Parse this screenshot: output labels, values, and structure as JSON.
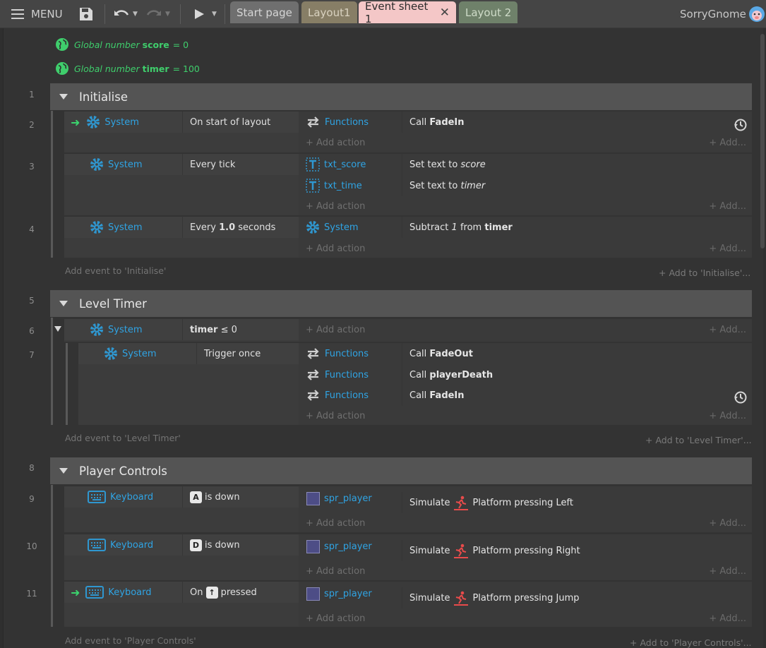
{
  "topbar": {
    "menu_label": "MENU",
    "user": "SorryGnome",
    "tabs": [
      {
        "label": "Start page"
      },
      {
        "label": "Layout1"
      },
      {
        "label": "Event sheet 1"
      },
      {
        "label": "Layout 2"
      }
    ]
  },
  "globals": [
    {
      "prefix": "Global number",
      "name": "score",
      "value": "= 0"
    },
    {
      "prefix": "Global number",
      "name": "timer",
      "value": "= 100"
    }
  ],
  "groups": [
    {
      "num": "1",
      "title": "Initialise",
      "add_event": "Add event to 'Initialise'",
      "add_to": "Add to 'Initialise'..."
    },
    {
      "num": "5",
      "title": "Level Timer",
      "add_event": "Add event to 'Level Timer'",
      "add_to": "Add to 'Level Timer'..."
    },
    {
      "num": "8",
      "title": "Player Controls",
      "add_event": "Add event to 'Player Controls'",
      "add_to": "Add to 'Player Controls'..."
    }
  ],
  "labels": {
    "add_action": "Add action",
    "add_more": "Add..."
  },
  "events": {
    "e2": {
      "num": "2",
      "cond_obj": "System",
      "cond": "On start of layout",
      "actions": [
        {
          "obj": "Functions",
          "pre": "Call",
          "bold": "FadeIn"
        }
      ]
    },
    "e3": {
      "num": "3",
      "cond_obj": "System",
      "cond": "Every tick",
      "actions": [
        {
          "obj": "txt_score",
          "pre": "Set text to",
          "it": "score"
        },
        {
          "obj": "txt_time",
          "pre": "Set text to",
          "it": "timer"
        }
      ]
    },
    "e4": {
      "num": "4",
      "cond_obj": "System",
      "cond_pre": "Every",
      "cond_bold": "1.0",
      "cond_post": "seconds",
      "actions": [
        {
          "obj": "System",
          "pre": "Subtract",
          "it": "1",
          "mid": "from",
          "bold": "timer"
        }
      ]
    },
    "e6": {
      "num": "6",
      "cond_obj": "System",
      "cond_bold": "timer",
      "cond_post": "≤ 0"
    },
    "e7": {
      "num": "7",
      "cond_obj": "System",
      "cond": "Trigger once",
      "actions": [
        {
          "obj": "Functions",
          "pre": "Call",
          "bold": "FadeOut"
        },
        {
          "obj": "Functions",
          "pre": "Call",
          "bold": "playerDeath"
        },
        {
          "obj": "Functions",
          "pre": "Call",
          "bold": "FadeIn"
        }
      ]
    },
    "e9": {
      "num": "9",
      "cond_obj": "Keyboard",
      "key": "A",
      "cond_post": "is down",
      "actions": [
        {
          "obj": "spr_player",
          "pre": "Simulate",
          "post": "Platform pressing Left"
        }
      ]
    },
    "e10": {
      "num": "10",
      "cond_obj": "Keyboard",
      "key": "D",
      "cond_post": "is down",
      "actions": [
        {
          "obj": "spr_player",
          "pre": "Simulate",
          "post": "Platform pressing Right"
        }
      ]
    },
    "e11": {
      "num": "11",
      "cond_obj": "Keyboard",
      "cond_pre": "On",
      "key": "↑",
      "cond_post": "pressed",
      "actions": [
        {
          "obj": "spr_player",
          "pre": "Simulate",
          "post": "Platform pressing Jump"
        }
      ]
    }
  }
}
